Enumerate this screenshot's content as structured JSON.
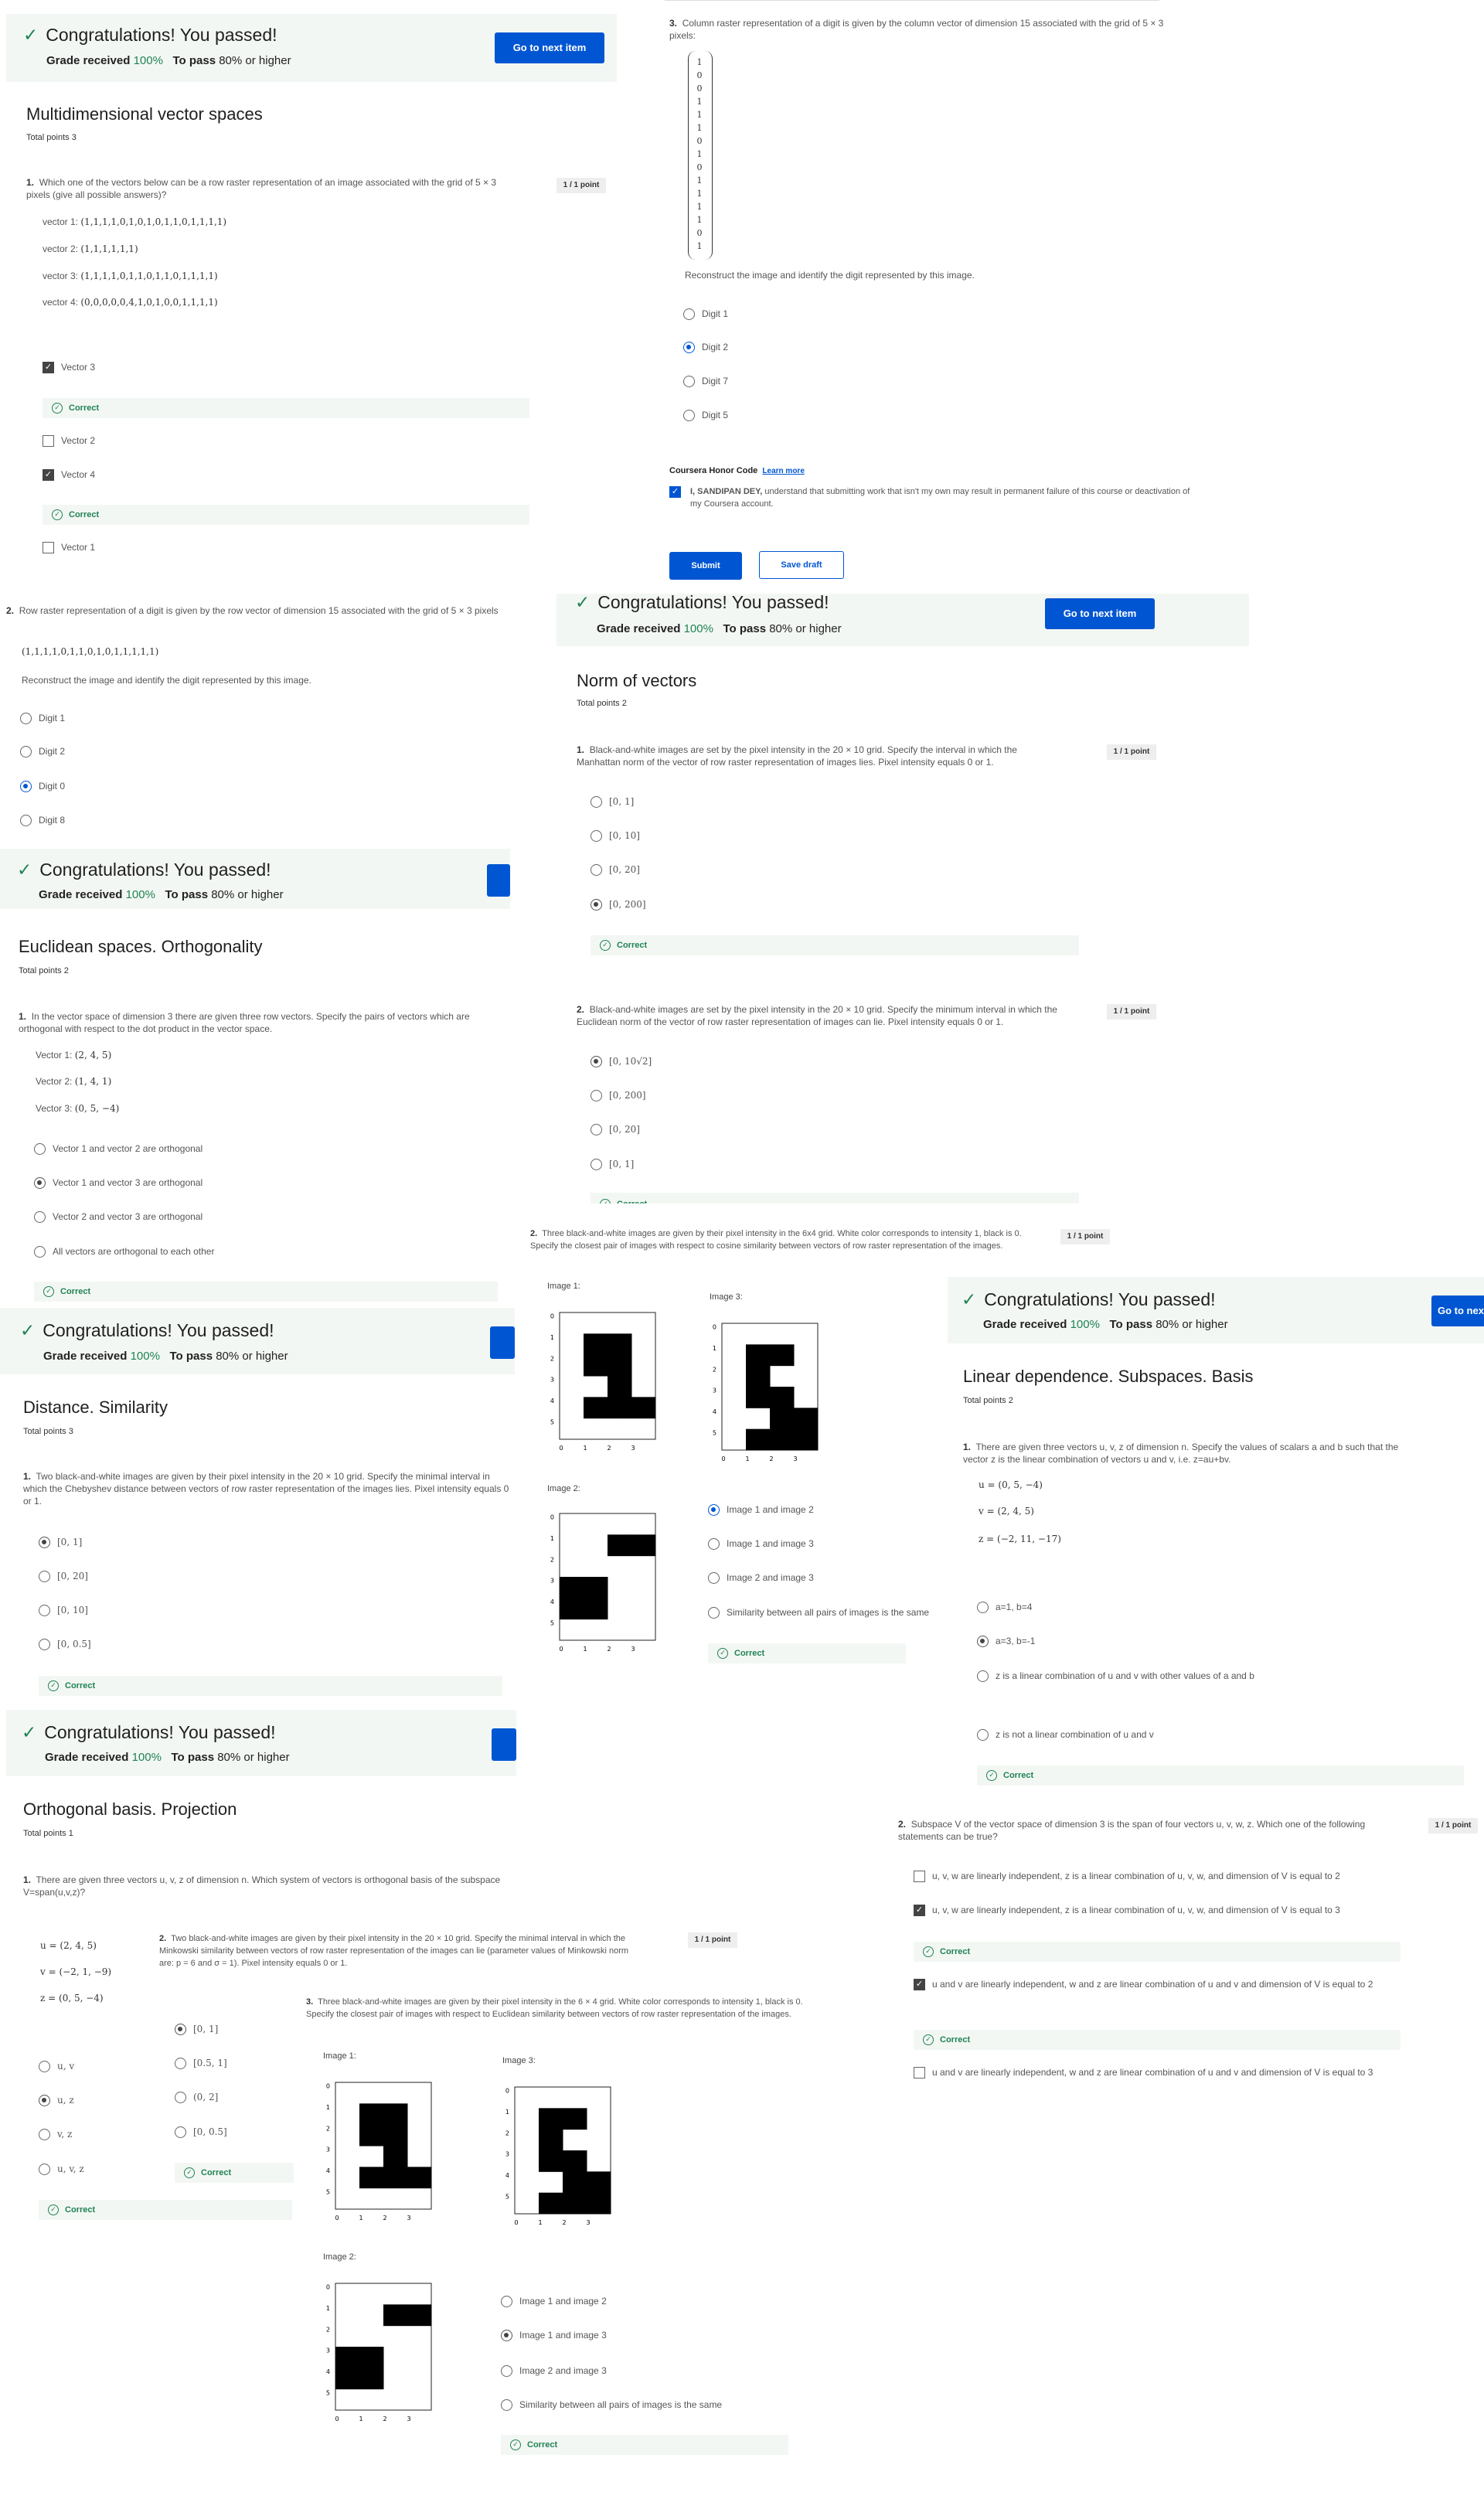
{
  "common": {
    "congrats": "Congratulations! You passed!",
    "grade_label": "Grade received",
    "grade_value": "100%",
    "pass_label": "To pass",
    "pass_value": "80% or higher",
    "next_item": "Go to next item",
    "correct": "Correct",
    "point": "1 / 1 point",
    "check": "✓"
  },
  "quiz_multidim": {
    "title": "Multidimensional vector spaces",
    "total_points": "Total points 3",
    "q1": {
      "num": "1.",
      "text": "Which one of the vectors below can be a row raster representation of an image associated with the grid of 5 × 3 pixels (give all possible answers)?",
      "vectors": [
        {
          "label": "vector 1:",
          "value": "(1,1,1,1,0,1,0,1,0,1,1,0,1,1,1,1)"
        },
        {
          "label": "vector 2:",
          "value": "(1,1,1,1,1,1)"
        },
        {
          "label": "vector 3:",
          "value": "(1,1,1,1,0,1,1,0,1,1,0,1,1,1,1)"
        },
        {
          "label": "vector 4:",
          "value": "(0,0,0,0,0,4,1,0,1,0,0,1,1,1,1)"
        }
      ],
      "options": [
        "Vector 3",
        "Vector 2",
        "Vector 4",
        "Vector 1"
      ]
    },
    "q2": {
      "num": "2.",
      "text": "Row raster representation of a digit is given by the row vector of dimension 15 associated with the grid of 5 × 3 pixels",
      "vector": "(1,1,1,1,0,1,1,0,1,0,1,1,1,1,1)",
      "instruction": "Reconstruct the image and identify the digit represented by this image.",
      "options": [
        "Digit 1",
        "Digit 2",
        "Digit 0",
        "Digit 8"
      ]
    },
    "q3": {
      "num": "3.",
      "text": "Column raster representation of a digit is given by the column vector of dimension 15 associated with the grid of 5 × 3 pixels:",
      "column": [
        "1",
        "0",
        "0",
        "1",
        "1",
        "1",
        "0",
        "1",
        "0",
        "1",
        "1",
        "1",
        "1",
        "0",
        "1"
      ],
      "instruction": "Reconstruct the image and identify the digit represented by this image.",
      "options": [
        "Digit 1",
        "Digit 2",
        "Digit 7",
        "Digit 5"
      ]
    },
    "honor": {
      "title": "Coursera Honor Code",
      "learn_more": "Learn more",
      "name": "I, SANDIPAN DEY,",
      "text": "understand that submitting work that isn't my own may result in permanent failure of this course or deactivation of my Coursera account."
    },
    "submit": "Submit",
    "save_draft": "Save draft"
  },
  "quiz_norm": {
    "title": "Norm of vectors",
    "total_points": "Total points 2",
    "q1": {
      "num": "1.",
      "text": "Black-and-white images are set by the pixel intensity in the 20 × 10 grid. Specify the interval in which the Manhattan norm of the vector of row raster representation of images lies. Pixel intensity equals 0 or 1.",
      "options": [
        "[0, 1]",
        "[0, 10]",
        "[0, 20]",
        "[0, 200]"
      ]
    },
    "q2": {
      "num": "2.",
      "text": "Black-and-white images are set by the pixel intensity in the 20 × 10 grid. Specify the minimum interval in which the Euclidean norm of the vector of row raster representation of images can lie. Pixel intensity equals 0 or 1.",
      "options": [
        "[0, 10√2]",
        "[0, 200]",
        "[0, 20]",
        "[0, 1]"
      ]
    }
  },
  "quiz_euclid": {
    "title": "Euclidean spaces. Orthogonality",
    "total_points": "Total points 2",
    "q1": {
      "num": "1.",
      "text": "In the vector space of dimension 3 there are given three row vectors. Specify the pairs of vectors which are orthogonal with respect to the dot product in the vector space.",
      "vectors": [
        {
          "label": "Vector 1:",
          "value": "(2, 4, 5)"
        },
        {
          "label": "Vector 2:",
          "value": "(1, 4, 1)"
        },
        {
          "label": "Vector 3:",
          "value": "(0, 5, −4)"
        }
      ],
      "options": [
        "Vector 1 and vector 2 are orthogonal",
        "Vector 1 and vector 3 are orthogonal",
        "Vector 2 and vector 3 are orthogonal",
        "All vectors are orthogonal to each other"
      ]
    },
    "q2": {
      "num": "2.",
      "text": "Three black-and-white images are given by their pixel intensity in the 6x4 grid. White color corresponds to intensity 1, black is 0. Specify the closest pair of images with respect to cosine similarity between vectors of row raster representation of the images.",
      "options": [
        "Image 1 and image 2",
        "Image 1 and image 3",
        "Image 2 and image 3",
        "Similarity between all pairs of images is the same"
      ]
    }
  },
  "quiz_distance": {
    "title": "Distance. Similarity",
    "total_points": "Total points 3",
    "q1": {
      "num": "1.",
      "text": "Two black-and-white images are given by their pixel intensity in the 20 × 10 grid. Specify the minimal interval in which the Chebyshev distance between vectors of row raster representation of the images lies. Pixel intensity equals 0 or 1.",
      "options": [
        "[0, 1]",
        "[0, 20]",
        "[0, 10]",
        "[0, 0.5]"
      ]
    },
    "q2": {
      "num": "2.",
      "text": "Two black-and-white images are given by their pixel intensity in the 20 × 10 grid. Specify the minimal interval in which the Minkowski similarity between vectors of row raster representation of the images can lie (parameter values of Minkowski norm are: p = 6 and σ = 1). Pixel intensity equals 0 or 1.",
      "options": [
        "[0, 1]",
        "[0.5, 1]",
        "(0, 2]",
        "[0, 0.5]"
      ]
    },
    "q3": {
      "num": "3.",
      "text": "Three black-and-white images are given by their pixel intensity in the 6 × 4 grid. White color corresponds to intensity 1, black is 0. Specify the closest pair of images with respect to Euclidean similarity between vectors of row raster representation of the images.",
      "options": [
        "Image 1 and image 2",
        "Image 1 and image 3",
        "Image 2 and image 3",
        "Similarity between all pairs of images is the same"
      ]
    }
  },
  "quiz_orth": {
    "title": "Orthogonal basis. Projection",
    "total_points": "Total points 1",
    "q1": {
      "num": "1.",
      "text": "There are given three vectors u, v, z of dimension n. Which system of vectors is orthogonal basis of the subspace V=span(u,v,z)?",
      "vectors": [
        "u = (2, 4, 5)",
        "v = (−2, 1, −9)",
        "z = (0, 5, −4)"
      ],
      "options": [
        "u, v",
        "u, z",
        "v, z",
        "u, v, z"
      ]
    }
  },
  "quiz_lindep": {
    "title": "Linear dependence. Subspaces. Basis",
    "total_points": "Total points 2",
    "q1": {
      "num": "1.",
      "text": "There are given three vectors u, v, z of dimension n. Specify the values of scalars a and b such that the vector z is the linear combination of vectors u and v, i.e. z=au+bv.",
      "vectors": [
        "u = (0, 5, −4)",
        "v = (2, 4, 5)",
        "z = (−2, 11, −17)"
      ],
      "options": [
        "a=1, b=4",
        "a=3, b=-1",
        "z is a linear combination of u and v with other values of a and b",
        "z is not a linear combination of u and v"
      ]
    },
    "q2": {
      "num": "2.",
      "text": "Subspace V of the vector space of dimension 3 is the span of four vectors u, v, w, z. Which one of the following statements can be true?",
      "options": [
        "u, v, w are linearly independent, z is a linear combination of u, v, w, and dimension of V is equal to 2",
        "u, v, w are linearly independent, z is a linear combination of u, v, w, and dimension of V is equal to 3",
        "u and v are linearly independent, w and z are linear combination of u and v and dimension of V is equal to 2",
        "u and v are linearly independent, w and z are linear combination of u and v and dimension of V is equal to 3"
      ]
    }
  },
  "images": {
    "image1": "Image 1:",
    "image2": "Image 2:",
    "image3": "Image 3:",
    "x_ticks": [
      "0",
      "1",
      "2",
      "3"
    ],
    "y_ticks": [
      "0",
      "1",
      "2",
      "3",
      "4",
      "5"
    ]
  }
}
